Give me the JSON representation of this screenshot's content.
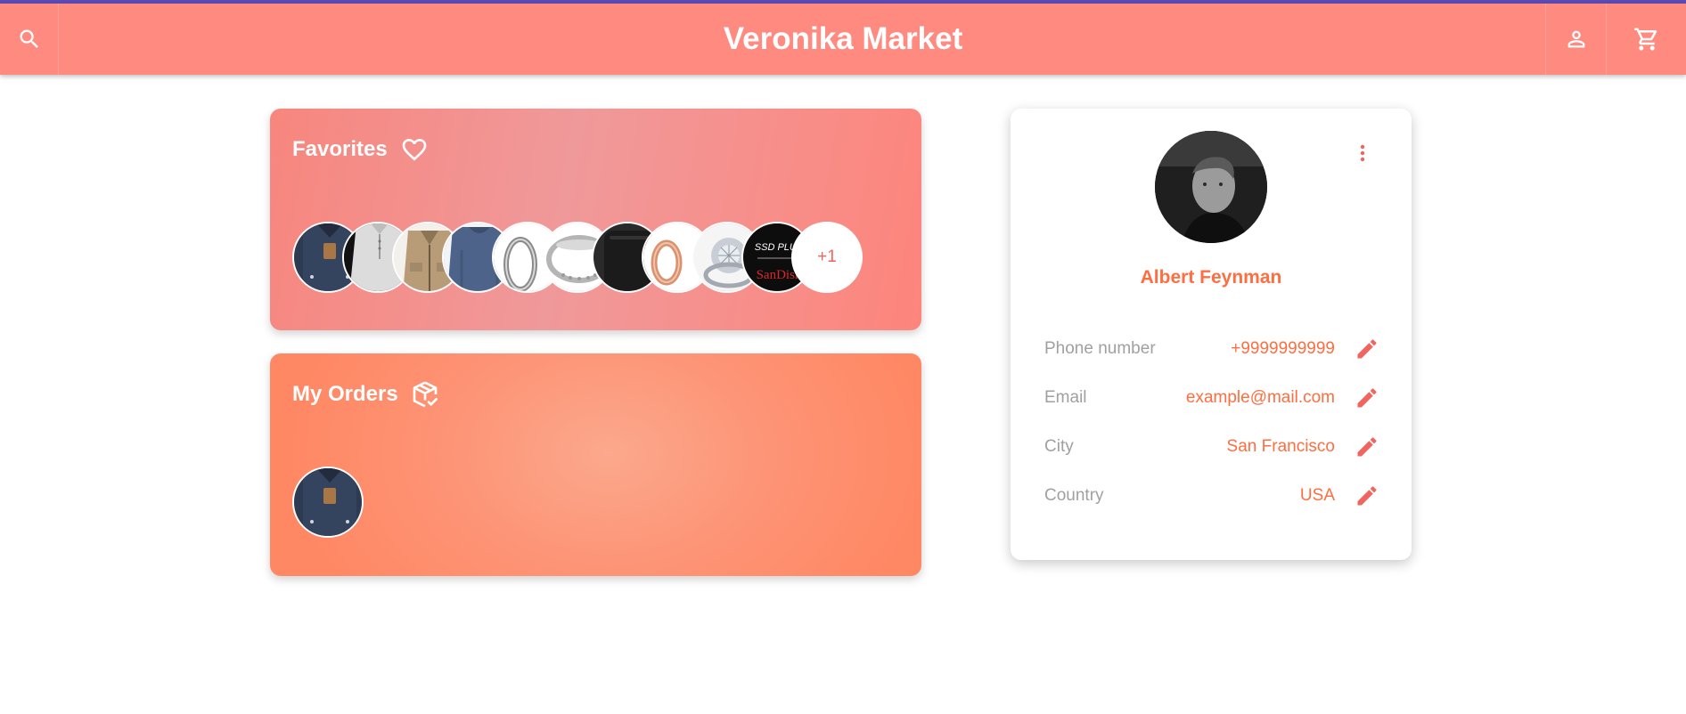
{
  "app": {
    "title": "Veronika Market"
  },
  "header": {
    "search_icon": "search-icon",
    "account_icon": "person-icon",
    "cart_icon": "shopping-cart-icon"
  },
  "favorites": {
    "title": "Favorites",
    "icon": "heart-outline-icon",
    "items": [
      {
        "name": "navy-jacket"
      },
      {
        "name": "white-henley"
      },
      {
        "name": "khaki-jacket"
      },
      {
        "name": "blue-sweater"
      },
      {
        "name": "silver-ring"
      },
      {
        "name": "diamond-band"
      },
      {
        "name": "black-item"
      },
      {
        "name": "rose-gold-ring"
      },
      {
        "name": "diamond-ring"
      },
      {
        "name": "sandisk-ssd"
      }
    ],
    "more_label": "+1"
  },
  "orders": {
    "title": "My Orders",
    "icon": "package-check-icon",
    "items": [
      {
        "name": "navy-jacket"
      }
    ]
  },
  "profile": {
    "name": "Albert Feynman",
    "menu_icon": "more-vertical-icon",
    "fields": [
      {
        "label": "Phone number",
        "value": "+9999999999"
      },
      {
        "label": "Email",
        "value": "example@mail.com"
      },
      {
        "label": "City",
        "value": "San Francisco"
      },
      {
        "label": "Country",
        "value": "USA"
      }
    ]
  },
  "colors": {
    "brand": "#ff8a80",
    "accent": "#ff6e40",
    "top_line": "#5c4bb5",
    "label_gray": "#a0a0a0"
  }
}
